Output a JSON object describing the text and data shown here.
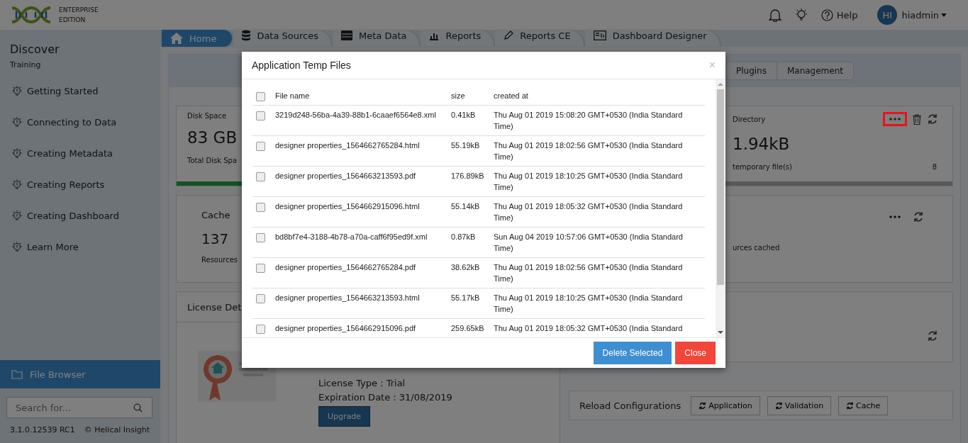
{
  "header": {
    "edition": [
      "ENTERPRISE",
      "EDITION"
    ],
    "help": "Help",
    "user": {
      "initials": "HI",
      "name": "hiadmin"
    }
  },
  "sidebar": {
    "title": "Discover",
    "subtitle": "Training",
    "items": [
      "Getting Started",
      "Connecting to Data",
      "Creating Metadata",
      "Creating Reports",
      "Creating Dashboard",
      "Learn More"
    ],
    "file_browser": "File Browser",
    "search": {
      "placeholder": "Search for..."
    },
    "version": "3.1.0.12539 RC1",
    "copyright": "© Helical Insight"
  },
  "tabs": [
    {
      "label": "Home",
      "selected": true
    },
    {
      "label": "Data Sources",
      "selected": false
    },
    {
      "label": "Meta Data",
      "selected": false
    },
    {
      "label": "Reports",
      "selected": false
    },
    {
      "label": "Reports CE",
      "selected": false
    },
    {
      "label": "Dashboard Designer",
      "selected": false
    }
  ],
  "subtabs": [
    "Plugins",
    "Management"
  ],
  "left_cards": [
    {
      "kind": "stat",
      "title": "Disk Space",
      "value": "83 GB",
      "caption": "Total Disk Spa"
    },
    {
      "kind": "cache",
      "title": "Cache",
      "value": "137",
      "caption": "Resources"
    },
    {
      "kind": "license",
      "title": "License Det",
      "lines": [
        "License Type : Trial",
        "Expiration Date : 31/08/2019"
      ],
      "button": "Upgrade"
    }
  ],
  "right_cards": [
    {
      "kind": "stat",
      "title": "Directory",
      "value": "1.94kB",
      "caption": "temporary file(s)",
      "count": "8",
      "more_highlighted": true
    },
    {
      "kind": "cache",
      "caption": "urces cached",
      "more_highlighted": false
    },
    {
      "kind": "blank"
    },
    {
      "kind": "reload",
      "title": "Reload Configurations",
      "buttons": [
        "Application",
        "Validation",
        "Cache"
      ]
    }
  ],
  "modal": {
    "title": "Application Temp Files",
    "close": "×",
    "select_all": {
      "checked": false
    },
    "columns": [
      "File name",
      "size",
      "created at"
    ],
    "rows": [
      {
        "name": "3219d248-56ba-4a39-88b1-6caaef6564e8.xml",
        "size": "0.41kB",
        "created": "Thu Aug 01 2019 15:08:20 GMT+0530 (India Standard Time)",
        "checked": false
      },
      {
        "name": "designer properties_1564662765284.html",
        "size": "55.19kB",
        "created": "Thu Aug 01 2019 18:02:56 GMT+0530 (India Standard Time)",
        "checked": false
      },
      {
        "name": "designer properties_1564663213593.pdf",
        "size": "176.89kB",
        "created": "Thu Aug 01 2019 18:10:25 GMT+0530 (India Standard Time)",
        "checked": false
      },
      {
        "name": "designer properties_1564662915096.html",
        "size": "55.14kB",
        "created": "Thu Aug 01 2019 18:05:32 GMT+0530 (India Standard Time)",
        "checked": false
      },
      {
        "name": "bd8bf7e4-3188-4b78-a70a-caff6f95ed9f.xml",
        "size": "0.87kB",
        "created": "Sun Aug 04 2019 10:57:06 GMT+0530 (India Standard Time)",
        "checked": false
      },
      {
        "name": "designer properties_1564662765284.pdf",
        "size": "38.62kB",
        "created": "Thu Aug 01 2019 18:02:56 GMT+0530 (India Standard Time)",
        "checked": false
      },
      {
        "name": "designer properties_1564663213593.html",
        "size": "55.17kB",
        "created": "Thu Aug 01 2019 18:10:25 GMT+0530 (India Standard Time)",
        "checked": false
      },
      {
        "name": "designer properties_1564662915096.pdf",
        "size": "259.65kB",
        "created": "Thu Aug 01 2019 18:05:32 GMT+0530 (India Standard",
        "checked": false
      }
    ],
    "buttons": [
      {
        "label": "Delete Selected",
        "kind": "primary"
      },
      {
        "label": "Close",
        "kind": "danger"
      }
    ]
  }
}
